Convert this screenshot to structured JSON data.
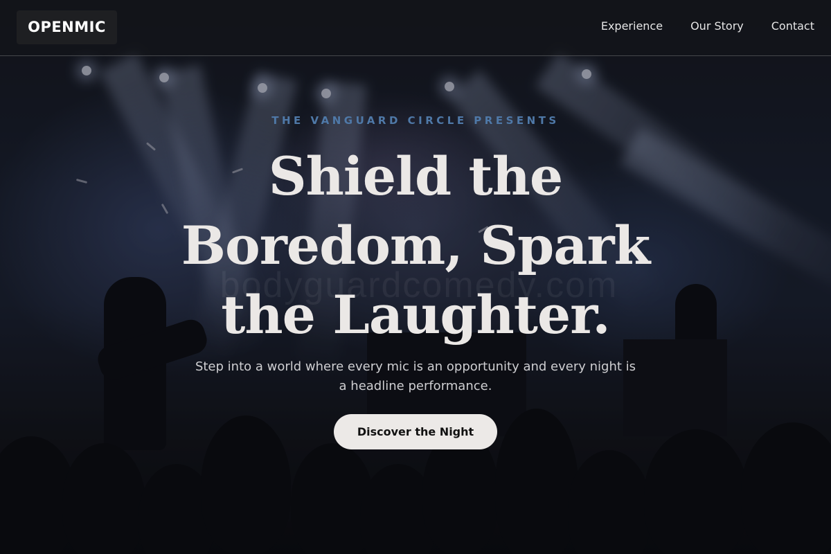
{
  "nav": {
    "logo": "OPENMIC",
    "links": [
      {
        "label": "Experience"
      },
      {
        "label": "Our Story"
      },
      {
        "label": "Contact"
      }
    ]
  },
  "hero": {
    "eyebrow": "THE VANGUARD CIRCLE PRESENTS",
    "headline_line1": "Shield the",
    "headline_line2": "Boredom, Spark",
    "headline_line3": "the Laughter.",
    "subtext": "Step into a world where every mic is an opportunity and every night is a headline performance.",
    "cta_label": "Discover the Night",
    "watermark": "bodyguardcomedy.com"
  },
  "colors": {
    "eyebrow": "#4f79a8",
    "headline": "#ebe8e6",
    "cta_background": "#ece9e7",
    "logo_background": "#1e1f22"
  }
}
